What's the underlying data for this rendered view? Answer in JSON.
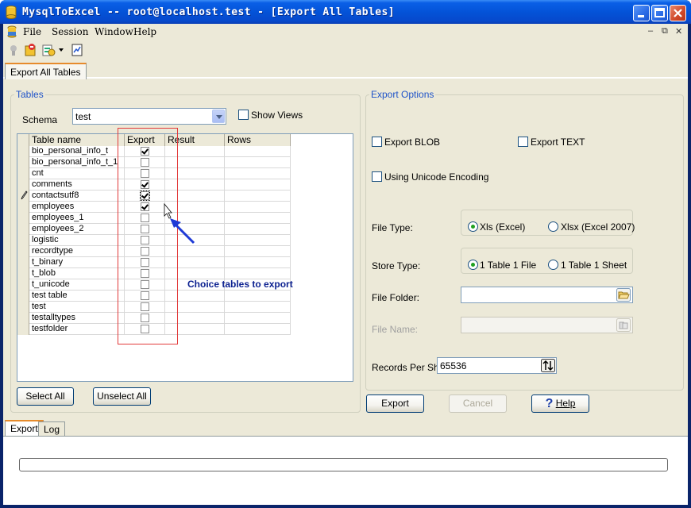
{
  "window": {
    "title": "MysqlToExcel -- root@localhost.test - [Export All Tables]"
  },
  "menu": [
    "File",
    "Session",
    "Window",
    "Help"
  ],
  "doc_tab": "Export All Tables",
  "tables_group": {
    "title": "Tables",
    "schema_label": "Schema",
    "schema_value": "test",
    "show_views_label": "Show Views",
    "show_views_checked": false,
    "columns": [
      "Table name",
      "Export",
      "Result",
      "Rows"
    ],
    "rows": [
      {
        "name": "bio_personal_info_t",
        "export": true
      },
      {
        "name": "bio_personal_info_t_1",
        "export": false
      },
      {
        "name": "cnt",
        "export": false
      },
      {
        "name": "comments",
        "export": true
      },
      {
        "name": "contactsutf8",
        "export": true
      },
      {
        "name": "employees",
        "export": true
      },
      {
        "name": "employees_1",
        "export": false
      },
      {
        "name": "employees_2",
        "export": false
      },
      {
        "name": "logistic",
        "export": false
      },
      {
        "name": "recordtype",
        "export": false
      },
      {
        "name": "t_binary",
        "export": false
      },
      {
        "name": "t_blob",
        "export": false
      },
      {
        "name": "t_unicode",
        "export": false
      },
      {
        "name": "test table",
        "export": false
      },
      {
        "name": "test",
        "export": false
      },
      {
        "name": "testalltypes",
        "export": false
      },
      {
        "name": "testfolder",
        "export": false
      }
    ],
    "select_all": "Select All",
    "unselect_all": "Unselect All"
  },
  "annotation": "Choice tables to export",
  "export_options": {
    "title": "Export Options",
    "export_blob": "Export BLOB",
    "export_text": "Export TEXT",
    "unicode": "Using Unicode Encoding",
    "file_type_label": "File Type:",
    "file_type_xls": "Xls (Excel)",
    "file_type_xlsx": "Xlsx (Excel 2007)",
    "store_type_label": "Store Type:",
    "store_one_file": "1 Table 1 File",
    "store_one_sheet": "1 Table 1 Sheet",
    "file_folder_label": "File Folder:",
    "file_folder_value": "",
    "file_name_label": "File Name:",
    "file_name_value": "",
    "records_label": "Records Per Sheet:",
    "records_value": "65536"
  },
  "buttons": {
    "export": "Export",
    "cancel": "Cancel",
    "help": "Help"
  },
  "bottom_tabs": [
    "Export",
    "Log"
  ],
  "colors": {
    "title_bar": "#0453d8",
    "group_title": "#1f53c8",
    "annotation": "#0a1f8f",
    "highlight_box": "#e23a3a"
  }
}
